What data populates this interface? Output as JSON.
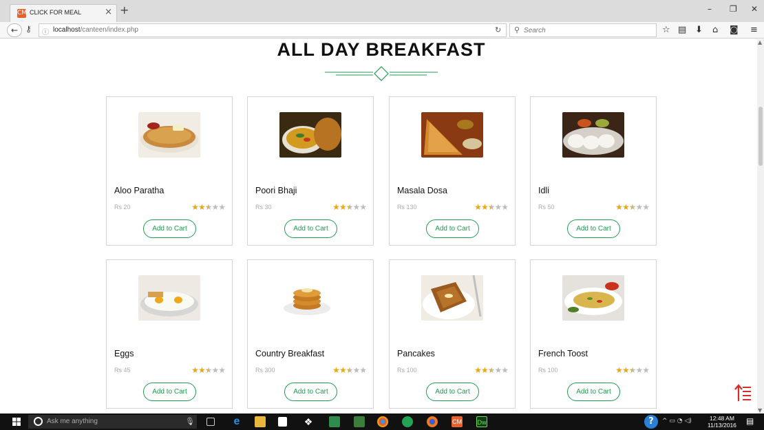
{
  "browser": {
    "tab_title": "CLICK FOR MEAL",
    "favicon_text": "CM",
    "url_host": "localhost",
    "url_path": "/canteen/index.php",
    "search_placeholder": "Search"
  },
  "section": {
    "title": "ALL DAY BREAKFAST"
  },
  "cart_label": "Add to Cart",
  "star_colors": {
    "on": "#e6a817",
    "off": "#bdbdbd"
  },
  "accent_color": "#1e9b4e",
  "items": [
    {
      "name": "Aloo Paratha",
      "price": "Rs 20",
      "rating": 2.5,
      "image": "paratha"
    },
    {
      "name": "Poori Bhaji",
      "price": "Rs 30",
      "rating": 2.5,
      "image": "poori"
    },
    {
      "name": "Masala Dosa",
      "price": "Rs 130",
      "rating": 2.5,
      "image": "dosa"
    },
    {
      "name": "Idli",
      "price": "Rs 50",
      "rating": 2.5,
      "image": "idli"
    },
    {
      "name": "Eggs",
      "price": "Rs 45",
      "rating": 2.5,
      "image": "eggs"
    },
    {
      "name": "Country Breakfast",
      "price": "Rs 300",
      "rating": 2.5,
      "image": "pancake-stack"
    },
    {
      "name": "Pancakes",
      "price": "Rs 100",
      "rating": 2.5,
      "image": "french-toast"
    },
    {
      "name": "French Toost",
      "price": "Rs 100",
      "rating": 2.5,
      "image": "omelette"
    }
  ],
  "taskbar": {
    "search_text": "Ask me anything",
    "time": "12:48 AM",
    "date": "11/13/2016",
    "dw_label": "Dw"
  }
}
